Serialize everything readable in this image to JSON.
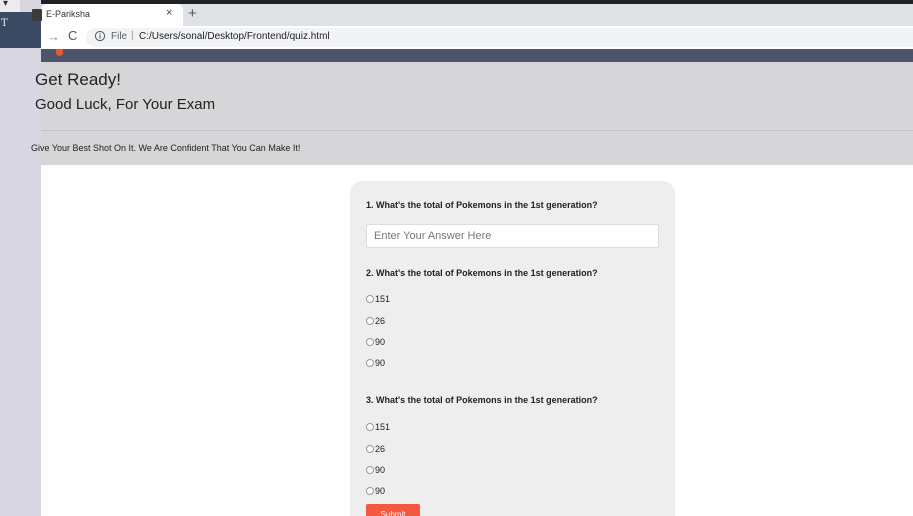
{
  "browser": {
    "tab_title": "E-Pariksha",
    "tab_close": "×",
    "new_tab": "+",
    "forward": "→",
    "reload": "C",
    "scheme": "File",
    "separator": "|",
    "url": "C:/Users/sonal/Desktop/Frontend/quiz.html"
  },
  "left_window": {
    "text": "T",
    "corner_glyph": "▾"
  },
  "header": {
    "title": "Get Ready!",
    "subtitle": "Good Luck, For Your Exam",
    "tagline": "Give Your Best Shot On It. We Are Confident That You Can Make It!"
  },
  "quiz": {
    "questions": [
      {
        "text": "1. What's the total of Pokemons in the 1st generation?",
        "placeholder": "Enter Your Answer Here",
        "value": ""
      },
      {
        "text": "2. What's the total of Pokemons in the 1st generation?",
        "options": [
          "151",
          "26",
          "90",
          "90"
        ]
      },
      {
        "text": "3. What's the total of Pokemons in the 1st generation?",
        "options": [
          "151",
          "26",
          "90",
          "90"
        ]
      }
    ],
    "submit_label": "Submit"
  },
  "colors": {
    "navbar": "#4b5468",
    "accent": "#e8552f",
    "submit": "#f15a3f",
    "header_bg": "#d6d6d9",
    "card_bg": "#eeeeee"
  }
}
